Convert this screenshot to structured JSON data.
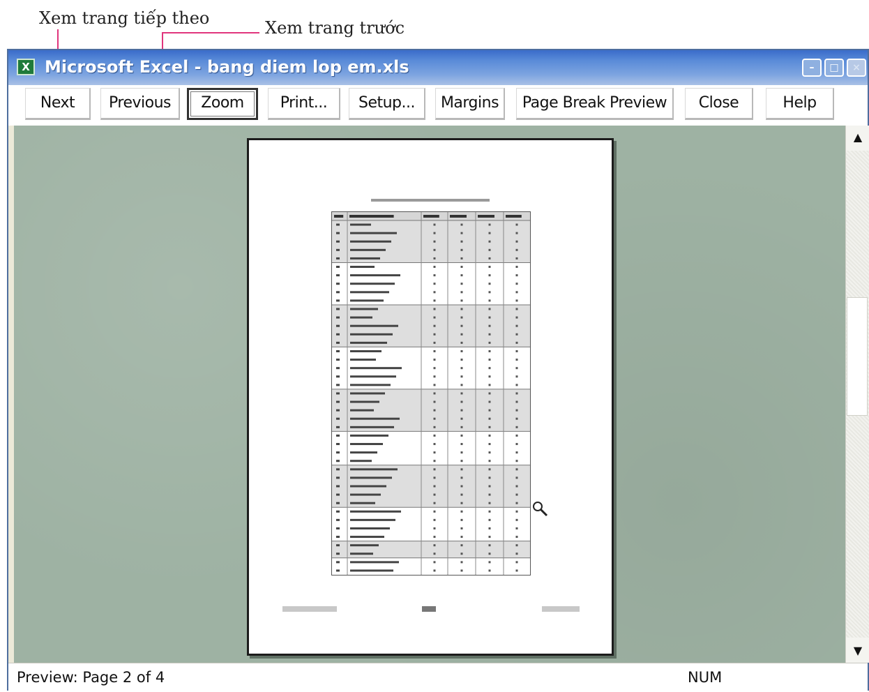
{
  "annotations": {
    "next_label": "Xem trang tiếp theo",
    "previous_label": "Xem trang trước",
    "arrow_color": "#e0357c"
  },
  "window": {
    "title": "Microsoft Excel - bang diem lop em.xls",
    "app_icon_glyph": "X",
    "minimize_glyph": "–",
    "maximize_glyph": "□",
    "close_glyph": "×"
  },
  "toolbar": {
    "buttons": [
      {
        "label": "Next"
      },
      {
        "label": "Previous"
      },
      {
        "label": "Zoom",
        "pressed": true
      },
      {
        "label": "Print..."
      },
      {
        "label": "Setup..."
      },
      {
        "label": "Margins"
      },
      {
        "label": "Page Break Preview"
      },
      {
        "label": "Close"
      },
      {
        "label": "Help"
      }
    ]
  },
  "preview": {
    "background_color": "#9eb2a3",
    "page_count_shown": 4,
    "current_page": 2,
    "cursor_icon": "magnifier-icon",
    "sheet_rows": 42,
    "sheet_columns": 6
  },
  "scrollbar": {
    "up_glyph": "▲",
    "down_glyph": "▼"
  },
  "status": {
    "text": "Preview: Page 2 of 4",
    "num_indicator": "NUM"
  }
}
